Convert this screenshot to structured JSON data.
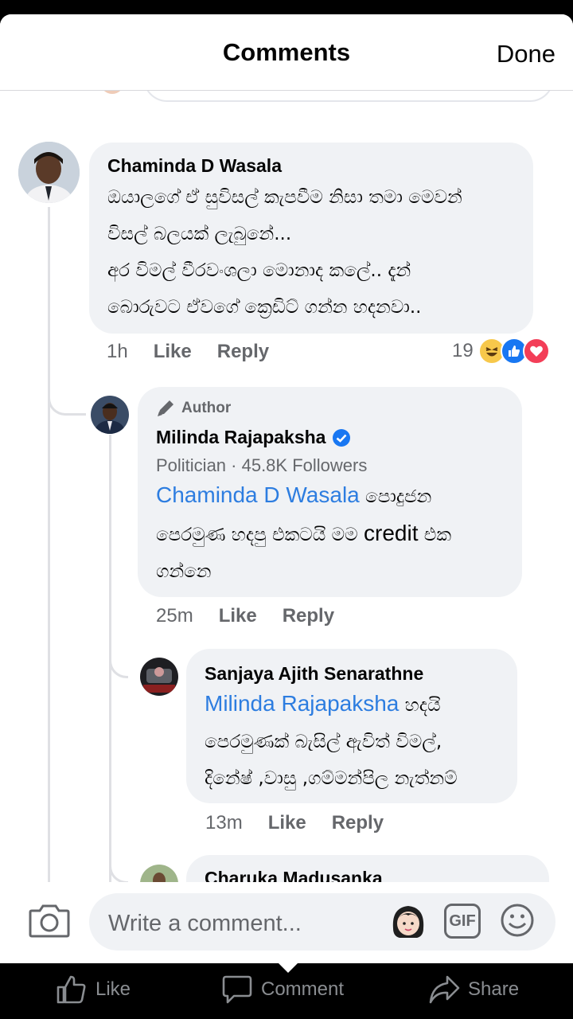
{
  "header": {
    "title": "Comments",
    "done_label": "Done"
  },
  "comments": [
    {
      "author": "Chaminda D Wasala",
      "lines": [
        "ඔයාලගේ ඒ සුවිසල් කැපවීම නිසා තමා මෙවන්",
        "විසල් බලයක් ලැබුනේ...",
        "අර විමල් වීරවංශලා මොනාද කලේ.. දැන්",
        "බොරුවට  ඒවගේ ක්‍රෙඩිට් ගන්න හදනවා.."
      ],
      "time": "1h",
      "like_label": "Like",
      "reply_label": "Reply",
      "reaction_count": "19",
      "reactions": [
        "haha",
        "like",
        "love"
      ]
    },
    {
      "badge": "Author",
      "author": "Milinda Rajapaksha",
      "verified": true,
      "subtitle": "Politician · 45.8K Followers",
      "mention": "Chaminda D Wasala",
      "lines": [
        " පොදුජන",
        "පෙරමුණ හදපු එකටයි මම ",
        "credit",
        " එක",
        "ගන්නෙ"
      ],
      "time": "25m",
      "like_label": "Like",
      "reply_label": "Reply"
    },
    {
      "author": "Sanjaya Ajith Senarathne",
      "mention": "Milinda Rajapaksha",
      "lines": [
        " හදයි",
        "පෙරමුණක් බැසිල් ඇවිත්  විමල්,",
        "දිනේෂ් ,වාසු ,ගම්මන්පිල නැත්නම්"
      ],
      "time": "13m",
      "like_label": "Like",
      "reply_label": "Reply"
    },
    {
      "author": "Charuka Madusanka"
    }
  ],
  "composer": {
    "placeholder": "Write a comment...",
    "gif_label": "GIF"
  },
  "bottom_bar": {
    "like": "Like",
    "comment": "Comment",
    "share": "Share"
  },
  "colors": {
    "accent": "#2d7de0",
    "bubble": "#f0f2f5",
    "muted": "#65676b"
  }
}
